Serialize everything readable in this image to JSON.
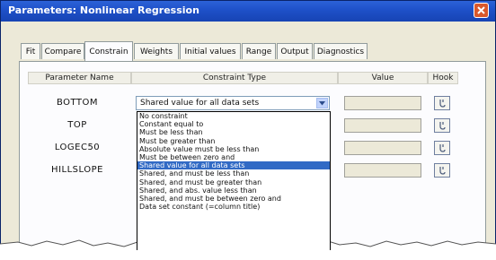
{
  "window": {
    "title": "Parameters: Nonlinear Regression"
  },
  "tabs": [
    {
      "label": "Fit"
    },
    {
      "label": "Compare"
    },
    {
      "label": "Constrain"
    },
    {
      "label": "Weights"
    },
    {
      "label": "Initial values"
    },
    {
      "label": "Range"
    },
    {
      "label": "Output"
    },
    {
      "label": "Diagnostics"
    }
  ],
  "active_tab": "Constrain",
  "columns": {
    "name": "Parameter Name",
    "type": "Constraint Type",
    "value": "Value",
    "hook": "Hook"
  },
  "parameters": [
    {
      "name": "BOTTOM"
    },
    {
      "name": "TOP"
    },
    {
      "name": "LOGEC50"
    },
    {
      "name": "HILLSLOPE"
    }
  ],
  "constraint_combo": {
    "selected": "Shared value for all data sets"
  },
  "dropdown": {
    "selected_index": 6,
    "options": [
      "No constraint",
      "Constant equal to",
      "Must be less than",
      "Must be greater than",
      "Absolute value must be less than",
      "Must be between zero and",
      "Shared value for all data sets",
      "Shared, and must be less than",
      "Shared, and must be greater than",
      "Shared, and abs. value less than",
      "Shared, and must be between zero and",
      "Data set constant (=column title)"
    ]
  },
  "icons": {
    "close": "close-icon",
    "dropdown": "chevron-down-icon",
    "hook": "hook-icon"
  },
  "colors": {
    "titlebar": "#1e50c8",
    "selection": "#316ac5",
    "close": "#d9582c"
  }
}
